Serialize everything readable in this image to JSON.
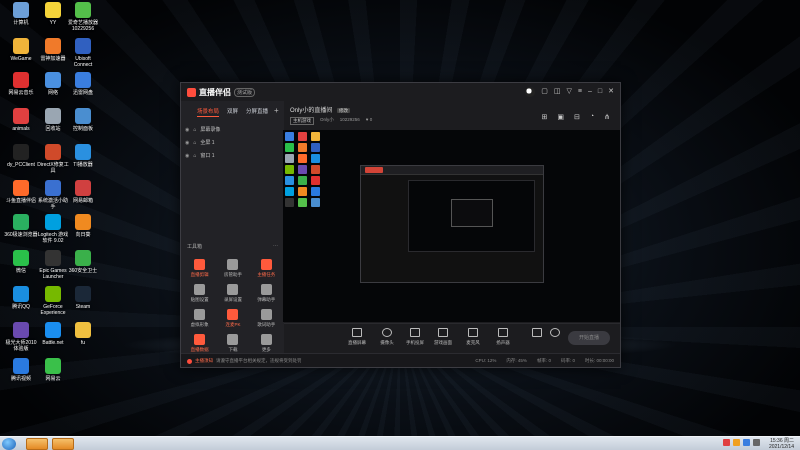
{
  "desktop": {
    "icons": [
      {
        "label": "计算机",
        "color": "#6c9fd8"
      },
      {
        "label": "YY",
        "color": "#f5d43a"
      },
      {
        "label": "爱奇艺播放器\n10229256",
        "color": "#54c04a"
      },
      {
        "label": "WeGame",
        "color": "#f0b43a"
      },
      {
        "label": "雷神加速器",
        "color": "#f07a2a"
      },
      {
        "label": "Ubisoft Connect",
        "color": "#3060c0"
      },
      {
        "label": "网易云音乐",
        "color": "#e03030"
      },
      {
        "label": "网络",
        "color": "#4a90e0"
      },
      {
        "label": "迅雷网盘",
        "color": "#3a7ee0"
      },
      {
        "label": "animals",
        "color": "#e04040"
      },
      {
        "label": "回收站",
        "color": "#9aa6b2"
      },
      {
        "label": "控制面板",
        "color": "#4a8ed0"
      },
      {
        "label": "dy_PCClient",
        "color": "#222222"
      },
      {
        "label": "DirectX修复工具",
        "color": "#d04a2a"
      },
      {
        "label": "TI播放器",
        "color": "#2a90e0"
      },
      {
        "label": "斗鱼直播伴侣",
        "color": "#ff6a2a"
      },
      {
        "label": "系统激活小助手",
        "color": "#3a70d0"
      },
      {
        "label": "网易邮箱",
        "color": "#d04040"
      },
      {
        "label": "360极速浏览器",
        "color": "#2ab060"
      },
      {
        "label": "Logitech 游戏软件 9.02",
        "color": "#00a0e0"
      },
      {
        "label": "向日葵",
        "color": "#f08a20"
      },
      {
        "label": "微信",
        "color": "#2ac04a"
      },
      {
        "label": "Epic Games Launcher",
        "color": "#333333"
      },
      {
        "label": "360安全卫士",
        "color": "#3ab04a"
      },
      {
        "label": "腾讯QQ",
        "color": "#1a8ee0"
      },
      {
        "label": "GeForce Experience",
        "color": "#76b900"
      },
      {
        "label": "Steam",
        "color": "#1b2838"
      },
      {
        "label": "极光大师2010体验版",
        "color": "#6a4ab0"
      },
      {
        "label": "Battle.net",
        "color": "#1a8ef0"
      },
      {
        "label": "fu",
        "color": "#f0c040"
      },
      {
        "label": "腾讯视频",
        "color": "#2a7ae0"
      },
      {
        "label": "网易云",
        "color": "#3ac04a"
      }
    ]
  },
  "taskbar": {
    "time": "15:36 周二",
    "date": "2021/12/14"
  },
  "app": {
    "name": "直播伴侣",
    "version": "测试版",
    "scene_tabs": [
      "场景布局",
      "双屏",
      "分屏直播"
    ],
    "add_tab": "+",
    "sources": [
      {
        "label": "屏幕录像"
      },
      {
        "label": "全屏 1"
      },
      {
        "label": "窗口 1"
      }
    ],
    "tools_title": "工具箱",
    "tools": [
      {
        "label": "直播剪辑",
        "hot": true,
        "color": "#ff5a3c"
      },
      {
        "label": "房管助手",
        "hot": false,
        "color": "#9a9a9a"
      },
      {
        "label": "主播任务",
        "hot": true,
        "color": "#ff5a3c"
      },
      {
        "label": "贴图设置",
        "hot": false,
        "color": "#9a9a9a"
      },
      {
        "label": "录屏设置",
        "hot": false,
        "color": "#9a9a9a"
      },
      {
        "label": "弹幕助手",
        "hot": false,
        "color": "#9a9a9a"
      },
      {
        "label": "虚拟形象",
        "hot": false,
        "color": "#9a9a9a"
      },
      {
        "label": "连麦PK",
        "hot": true,
        "color": "#ff5a3c"
      },
      {
        "label": "歌词助手",
        "hot": false,
        "color": "#9a9a9a"
      },
      {
        "label": "直播数据",
        "hot": true,
        "color": "#ff5a3c"
      },
      {
        "label": "下载",
        "hot": false,
        "color": "#9a9a9a"
      },
      {
        "label": "更多",
        "hot": false,
        "color": "#9a9a9a"
      }
    ],
    "room": {
      "title": "Only小的直播间",
      "edit": "修改",
      "category": "主机游戏",
      "owner": "Only小",
      "room_id": "10229256",
      "fans": "0"
    },
    "bottom_toolbar": [
      {
        "label": "直播屏幕"
      },
      {
        "label": "摄像头"
      },
      {
        "label": "手机投屏"
      },
      {
        "label": "游戏画面"
      },
      {
        "label": "麦克风"
      },
      {
        "label": "扬声器"
      }
    ],
    "start_live_label": "开始直播",
    "notice": {
      "prefix": "主播须知",
      "text": "请遵守直播平台相关规定，违规将受到处罚"
    },
    "stats": [
      "CPU: 12%",
      "内存: 45%",
      "帧率: 0",
      "码率: 0",
      "时长: 00:00:00"
    ]
  },
  "preview_icon_colors": [
    "#3a7ee0",
    "#e04040",
    "#f0b43a",
    "#2ac04a",
    "#f07a2a",
    "#3060c0",
    "#9aa6b2",
    "#ff6a2a",
    "#1a8ee0",
    "#76b900",
    "#6a4ab0",
    "#d04a2a",
    "#2a90e0",
    "#3ab04a",
    "#e03030",
    "#00a0e0",
    "#f08a20",
    "#2a7ae0",
    "#333333",
    "#54c04a",
    "#4a8ed0"
  ]
}
